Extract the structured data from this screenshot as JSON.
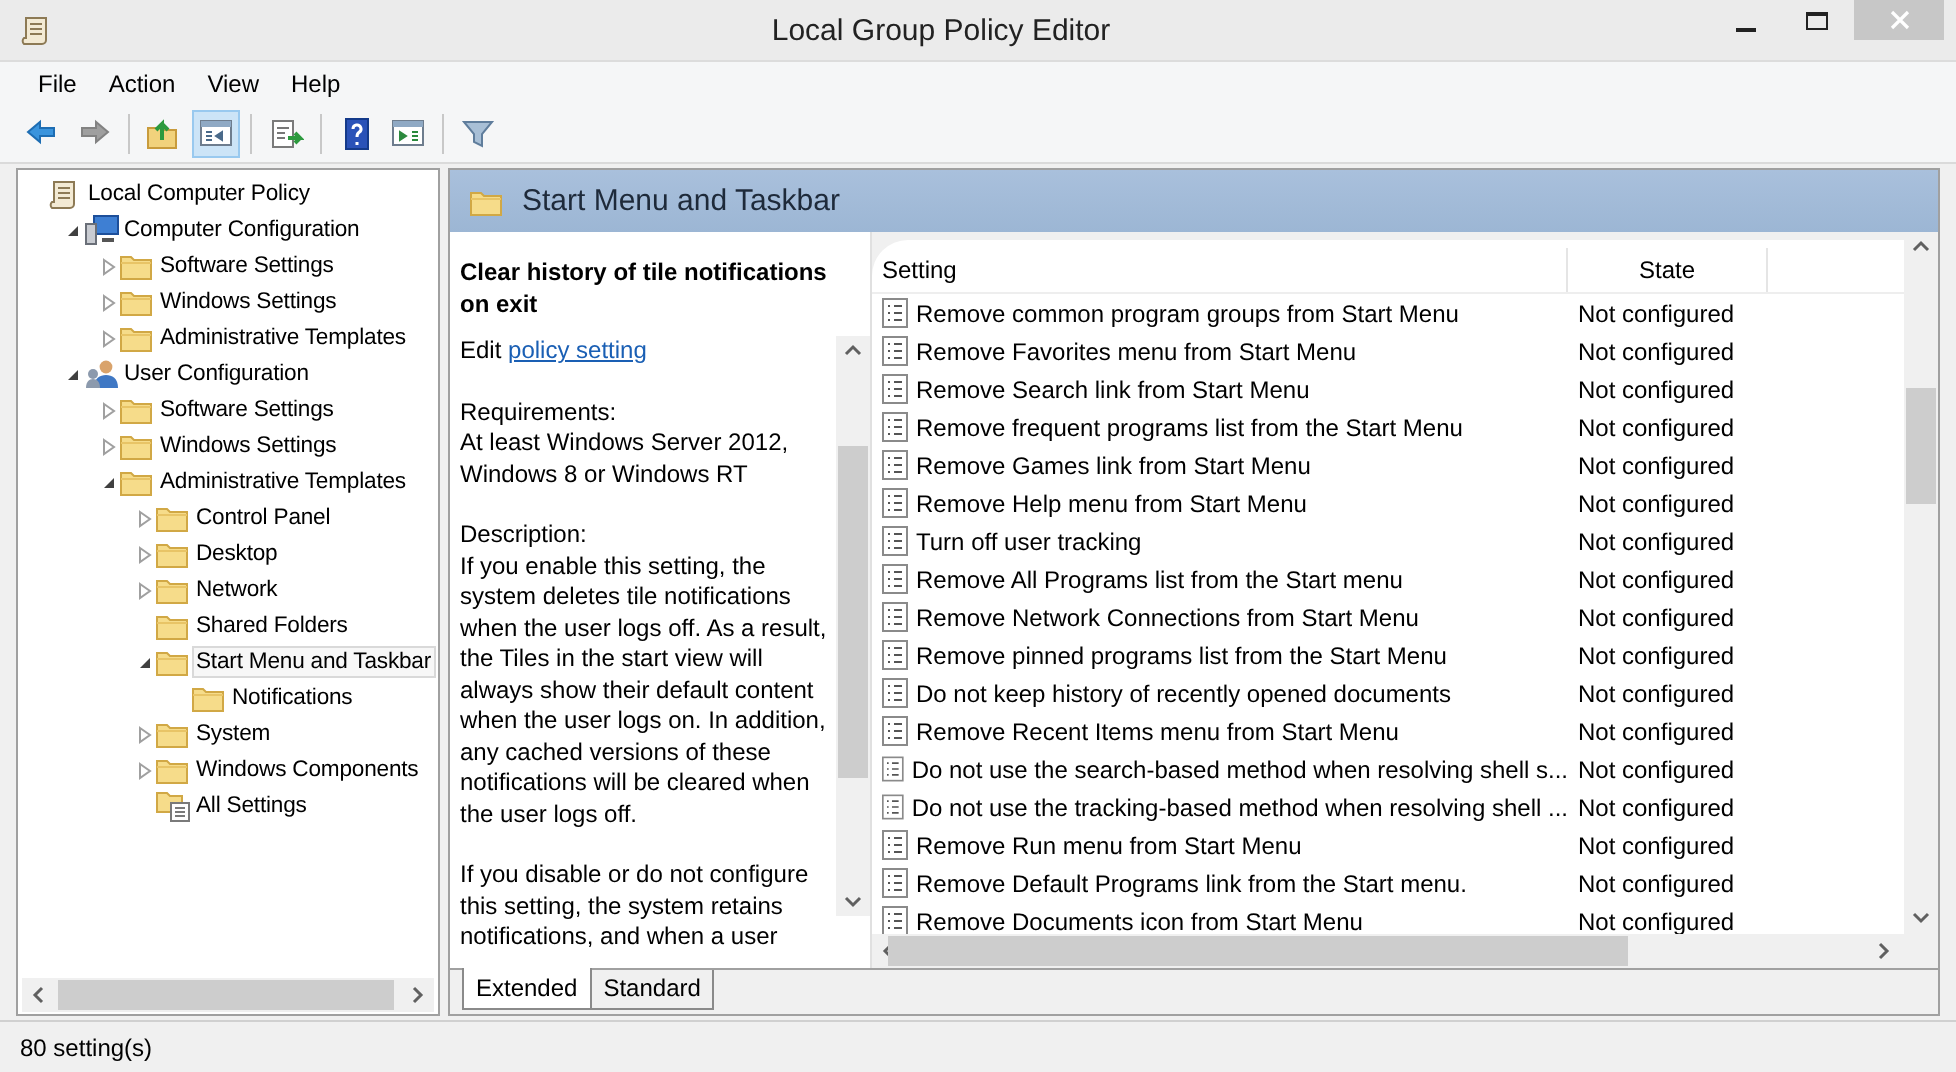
{
  "window": {
    "title": "Local Group Policy Editor"
  },
  "menu": [
    "File",
    "Action",
    "View",
    "Help"
  ],
  "toolbar": [
    [
      {
        "kind": "back",
        "pressed": false,
        "disabled": false
      },
      {
        "kind": "forward",
        "pressed": false,
        "disabled": true
      }
    ],
    [
      {
        "kind": "up",
        "pressed": false,
        "disabled": false
      },
      {
        "kind": "tree",
        "pressed": true,
        "disabled": false
      }
    ],
    [
      {
        "kind": "export",
        "pressed": false,
        "disabled": false
      }
    ],
    [
      {
        "kind": "help",
        "pressed": false,
        "disabled": false
      },
      {
        "kind": "pane",
        "pressed": false,
        "disabled": false
      }
    ],
    [
      {
        "kind": "filter",
        "pressed": false,
        "disabled": false
      }
    ]
  ],
  "tree": {
    "items": [
      {
        "label": "Local Computer Policy",
        "kind": "policy",
        "selected": false,
        "children": [
          {
            "label": "Computer Configuration",
            "kind": "computer",
            "expanded": true,
            "selected": false,
            "children": [
              {
                "label": "Software Settings",
                "kind": "folder",
                "expanded": false,
                "selected": false
              },
              {
                "label": "Windows Settings",
                "kind": "folder",
                "expanded": false,
                "selected": false
              },
              {
                "label": "Administrative Templates",
                "kind": "folder",
                "expanded": false,
                "selected": false
              }
            ]
          },
          {
            "label": "User Configuration",
            "kind": "user",
            "expanded": true,
            "selected": false,
            "children": [
              {
                "label": "Software Settings",
                "kind": "folder",
                "expanded": false,
                "selected": false
              },
              {
                "label": "Windows Settings",
                "kind": "folder",
                "expanded": false,
                "selected": false
              },
              {
                "label": "Administrative Templates",
                "kind": "folder",
                "expanded": true,
                "selected": false,
                "children": [
                  {
                    "label": "Control Panel",
                    "kind": "folder",
                    "expanded": false,
                    "selected": false
                  },
                  {
                    "label": "Desktop",
                    "kind": "folder",
                    "expanded": false,
                    "selected": false
                  },
                  {
                    "label": "Network",
                    "kind": "folder",
                    "expanded": false,
                    "selected": false
                  },
                  {
                    "label": "Shared Folders",
                    "kind": "folder",
                    "selected": false
                  },
                  {
                    "label": "Start Menu and Taskbar",
                    "kind": "folder",
                    "expanded": true,
                    "selected": true,
                    "children": [
                      {
                        "label": "Notifications",
                        "kind": "folder",
                        "selected": false
                      }
                    ]
                  },
                  {
                    "label": "System",
                    "kind": "folder",
                    "expanded": false,
                    "selected": false
                  },
                  {
                    "label": "Windows Components",
                    "kind": "folder",
                    "expanded": false,
                    "selected": false
                  },
                  {
                    "label": "All Settings",
                    "kind": "allsettings",
                    "selected": false
                  }
                ]
              }
            ]
          }
        ]
      }
    ]
  },
  "details": {
    "header": "Start Menu and Taskbar",
    "description": {
      "title": "Clear history of tile notifications on exit",
      "edit_text": "Edit",
      "edit_link": "policy setting",
      "requirements_label": "Requirements:",
      "requirements": "At least Windows Server 2012, Windows 8 or Windows RT",
      "description_label": "Description:",
      "paragraphs": [
        "If you enable this setting, the system deletes tile notifications when the user logs off. As a result, the Tiles in the start view will always show their default content when the user logs on. In addition, any cached versions of these notifications will be cleared when the user logs off.",
        "If you disable or do not configure this setting, the system retains notifications, and when a user"
      ]
    },
    "columns": [
      "Setting",
      "State"
    ],
    "rows": [
      {
        "setting": "Remove common program groups from Start Menu",
        "state": "Not configured",
        "selected": false
      },
      {
        "setting": "Remove Favorites menu from Start Menu",
        "state": "Not configured",
        "selected": false
      },
      {
        "setting": "Remove Search link from Start Menu",
        "state": "Not configured",
        "selected": false
      },
      {
        "setting": "Remove frequent programs list from the Start Menu",
        "state": "Not configured",
        "selected": false
      },
      {
        "setting": "Remove Games link from Start Menu",
        "state": "Not configured",
        "selected": false
      },
      {
        "setting": "Remove Help menu from Start Menu",
        "state": "Not configured",
        "selected": false
      },
      {
        "setting": "Turn off user tracking",
        "state": "Not configured",
        "selected": false
      },
      {
        "setting": "Remove All Programs list from the Start menu",
        "state": "Not configured",
        "selected": false
      },
      {
        "setting": "Remove Network Connections from Start Menu",
        "state": "Not configured",
        "selected": false
      },
      {
        "setting": "Remove pinned programs list from the Start Menu",
        "state": "Not configured",
        "selected": false
      },
      {
        "setting": "Do not keep history of recently opened documents",
        "state": "Not configured",
        "selected": false
      },
      {
        "setting": "Remove Recent Items menu from Start Menu",
        "state": "Not configured",
        "selected": false
      },
      {
        "setting": "Do not use the search-based method when resolving shell s...",
        "state": "Not configured",
        "selected": false
      },
      {
        "setting": "Do not use the tracking-based method when resolving shell ...",
        "state": "Not configured",
        "selected": false
      },
      {
        "setting": "Remove Run menu from Start Menu",
        "state": "Not configured",
        "selected": false
      },
      {
        "setting": "Remove Default Programs link from the Start menu.",
        "state": "Not configured",
        "selected": false
      },
      {
        "setting": "Remove Documents icon from Start Menu",
        "state": "Not configured",
        "selected": false
      }
    ],
    "tabs": [
      {
        "label": "Extended",
        "selected": true
      },
      {
        "label": "Standard",
        "selected": false
      }
    ]
  },
  "status_bar": "80 setting(s)"
}
